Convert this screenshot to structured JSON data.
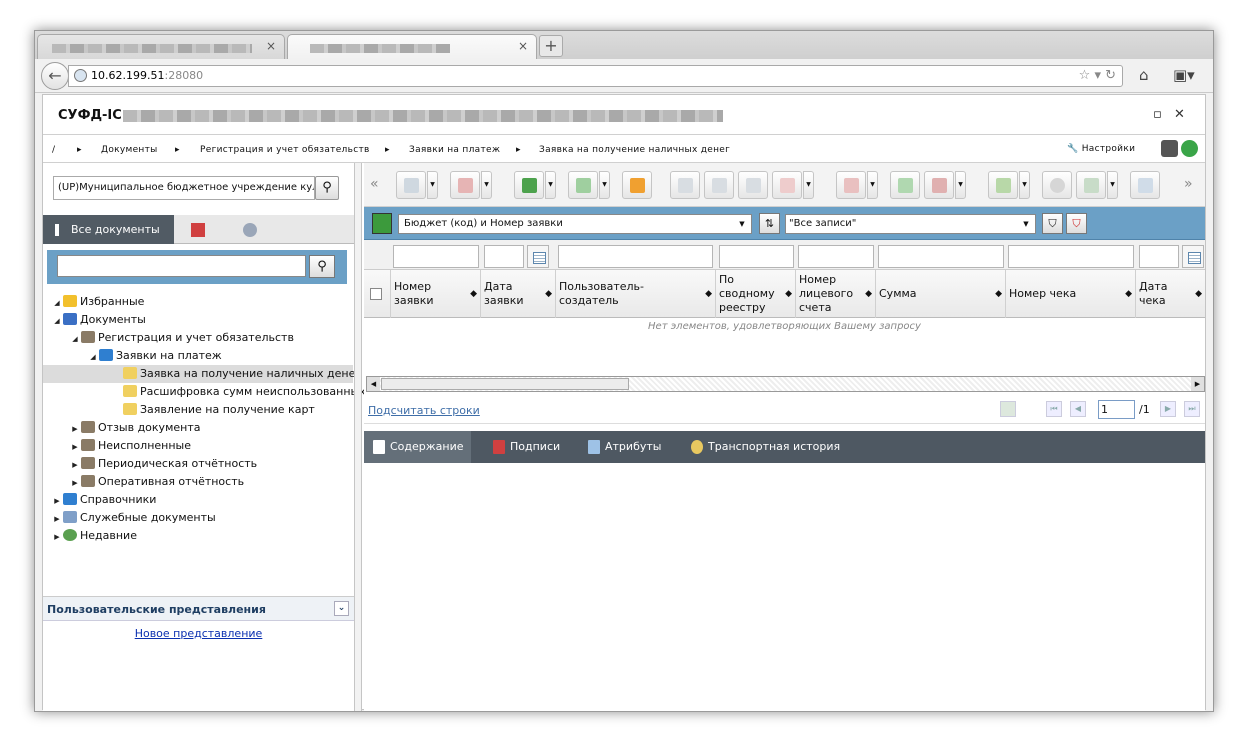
{
  "browser": {
    "url_host": "10.62.199.51",
    "url_port": ":28080",
    "new_tab_label": "+",
    "tab_close": "×"
  },
  "app": {
    "title": "СУФД-IС",
    "breadcrumb": {
      "root": "/",
      "items": [
        "Документы",
        "Регистрация и учет обязательств",
        "Заявки на платеж",
        "Заявка на получение наличных денег"
      ]
    },
    "settings_label": "Настройки"
  },
  "left": {
    "org_value": "(UP)Муниципальное бюджетное учреждение культ",
    "tab_all_documents": "Все документы",
    "tree": [
      {
        "label": "Избранные"
      },
      {
        "label": "Документы"
      },
      {
        "label": "Регистрация и учет обязательств"
      },
      {
        "label": "Заявки на платеж"
      },
      {
        "label": "Заявка на получение наличных денег"
      },
      {
        "label": "Расшифровка сумм неиспользованных"
      },
      {
        "label": "Заявление на получение карт"
      },
      {
        "label": "Отзыв документа"
      },
      {
        "label": "Неисполненные"
      },
      {
        "label": "Периодическая отчётность"
      },
      {
        "label": "Оперативная отчётность"
      },
      {
        "label": "Справочники"
      },
      {
        "label": "Служебные документы"
      },
      {
        "label": "Недавние"
      }
    ],
    "user_views_title": "Пользовательские представления",
    "new_view_link": "Новое представление"
  },
  "right": {
    "sort_select": "Бюджет (код) и Номер заявки",
    "filter_select": "\"Все записи\"",
    "columns": [
      "Номер заявки",
      "Дата заявки",
      "Пользователь-создатель",
      "По сводному реестру",
      "Номер лицевого счета",
      "Сумма",
      "Номер чека",
      "Дата чека"
    ],
    "empty_message": "Нет элементов, удовлетворяющих Вашему запросу",
    "count_rows_link": "Подсчитать строки",
    "page_current": "1",
    "page_total": "/1",
    "bottom_tabs": [
      "Содержание",
      "Подписи",
      "Атрибуты",
      "Транспортная история"
    ]
  }
}
